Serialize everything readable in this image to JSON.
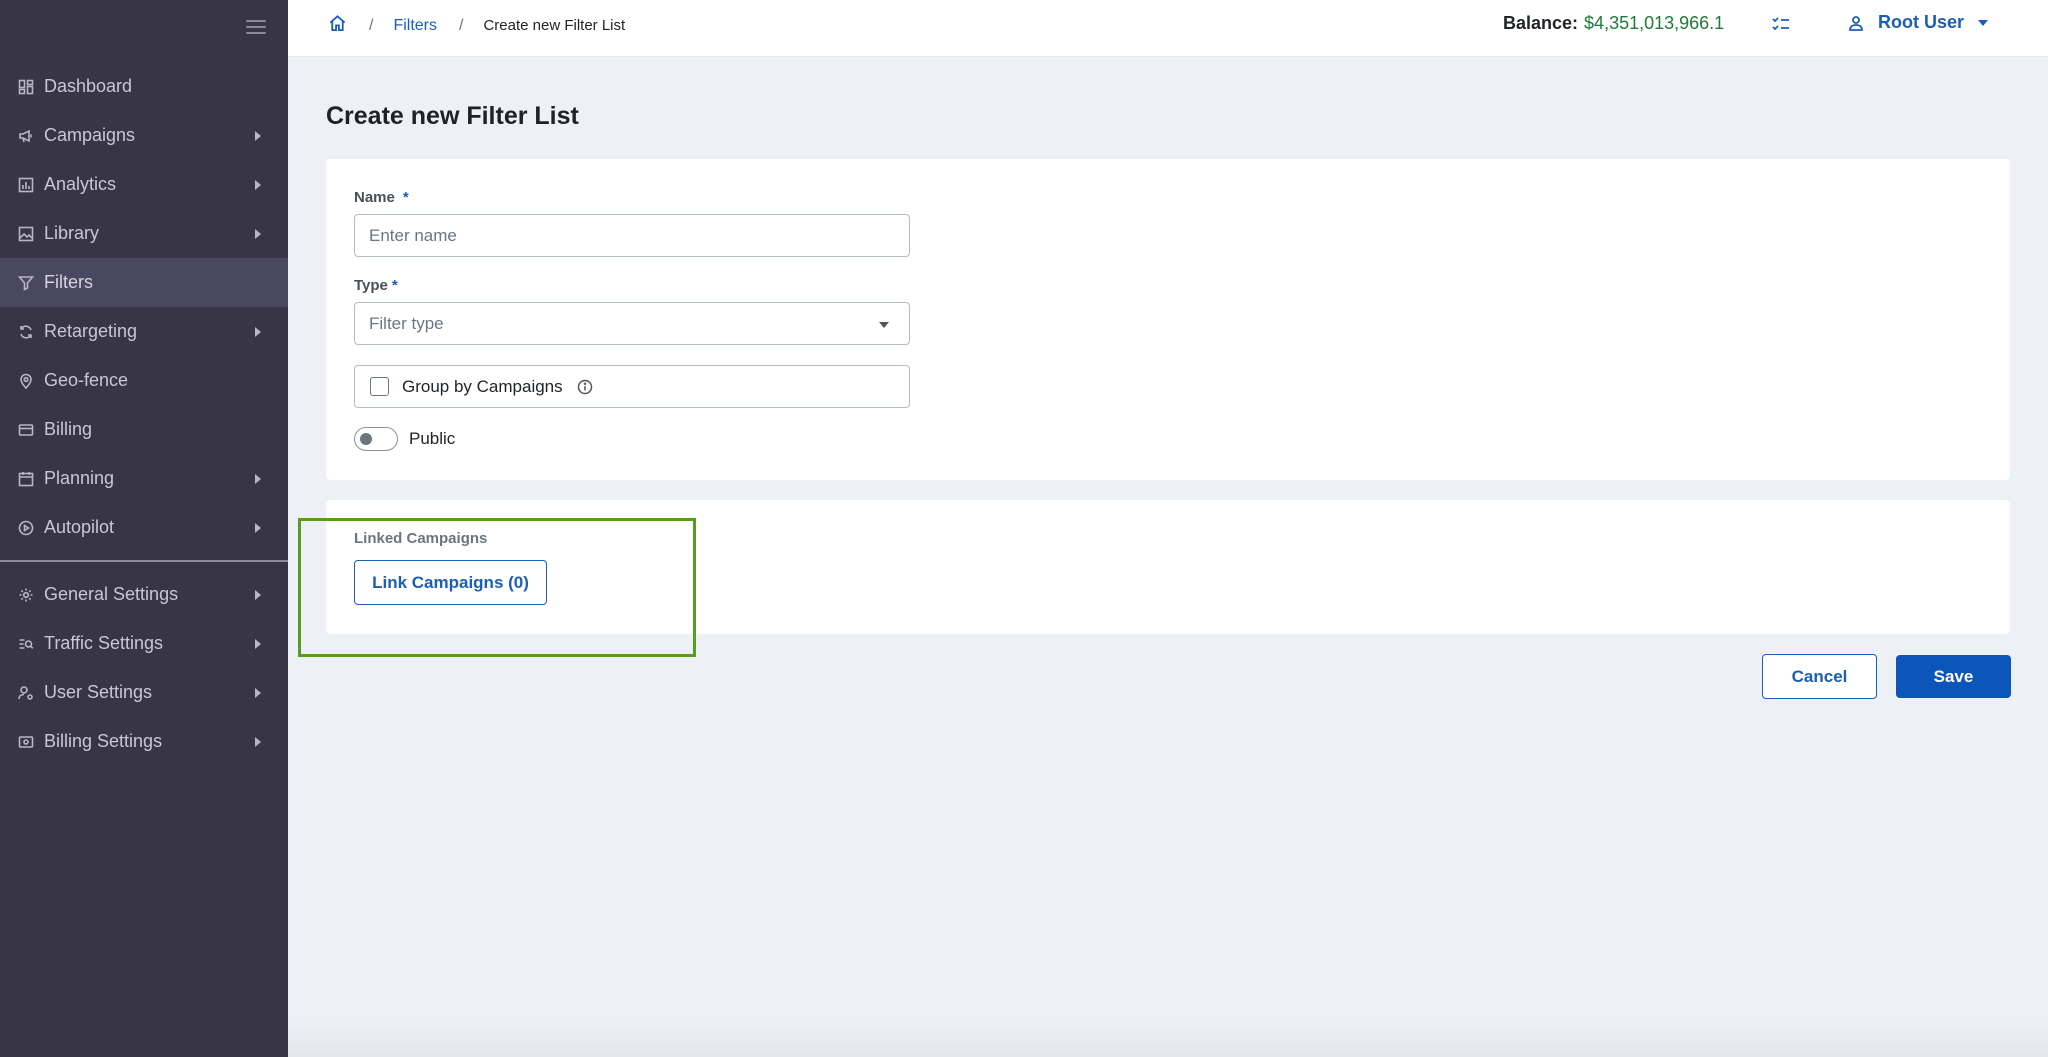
{
  "sidebar": {
    "items": [
      {
        "label": "Dashboard",
        "icon": "dashboard-icon",
        "has_submenu": false,
        "active": false
      },
      {
        "label": "Campaigns",
        "icon": "megaphone-icon",
        "has_submenu": true,
        "active": false
      },
      {
        "label": "Analytics",
        "icon": "chart-icon",
        "has_submenu": true,
        "active": false
      },
      {
        "label": "Library",
        "icon": "image-icon",
        "has_submenu": true,
        "active": false
      },
      {
        "label": "Filters",
        "icon": "filter-icon",
        "has_submenu": false,
        "active": true
      },
      {
        "label": "Retargeting",
        "icon": "refresh-icon",
        "has_submenu": true,
        "active": false
      },
      {
        "label": "Geo-fence",
        "icon": "map-pin-icon",
        "has_submenu": false,
        "active": false
      },
      {
        "label": "Billing",
        "icon": "credit-card-icon",
        "has_submenu": false,
        "active": false
      },
      {
        "label": "Planning",
        "icon": "calendar-icon",
        "has_submenu": true,
        "active": false
      },
      {
        "label": "Autopilot",
        "icon": "play-circle-icon",
        "has_submenu": true,
        "active": false
      }
    ],
    "settings_items": [
      {
        "label": "General Settings",
        "icon": "gear-icon",
        "has_submenu": true
      },
      {
        "label": "Traffic Settings",
        "icon": "list-search-icon",
        "has_submenu": true
      },
      {
        "label": "User Settings",
        "icon": "user-gear-icon",
        "has_submenu": true
      },
      {
        "label": "Billing Settings",
        "icon": "money-icon",
        "has_submenu": true
      }
    ]
  },
  "topbar": {
    "breadcrumb": {
      "home_icon": "home-icon",
      "sep": "/",
      "filters": "Filters",
      "current": "Create new Filter List"
    },
    "balance_label": "Balance:",
    "balance_value": "$4,351,013,966.1",
    "user_name": "Root User"
  },
  "main": {
    "title": "Create new Filter List",
    "name_label": "Name",
    "name_required": "*",
    "name_placeholder": "Enter name",
    "type_label": "Type",
    "type_required": "*",
    "type_placeholder": "Filter type",
    "group_by_label": "Group by Campaigns",
    "public_label": "Public",
    "linked_label": "Linked Campaigns",
    "link_button": "Link Campaigns (0)",
    "cancel": "Cancel",
    "save": "Save"
  },
  "colors": {
    "sidebar_bg": "#383547",
    "primary": "#0b56b8",
    "balance_green": "#1f7a3a",
    "highlight": "#5a9c22"
  }
}
